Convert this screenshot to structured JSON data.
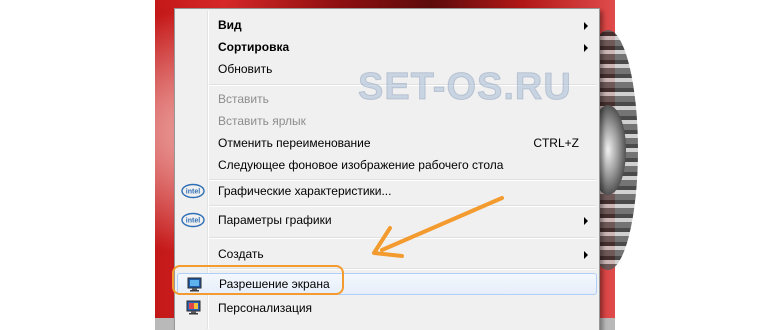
{
  "watermark": "SET-OS.RU",
  "menu": {
    "items": [
      {
        "label": "Вид",
        "shortcut": "",
        "submenu": true,
        "bold": true,
        "disabled": false,
        "icon": ""
      },
      {
        "label": "Сортировка",
        "shortcut": "",
        "submenu": true,
        "bold": true,
        "disabled": false,
        "icon": ""
      },
      {
        "label": "Обновить",
        "shortcut": "",
        "submenu": false,
        "bold": false,
        "disabled": false,
        "icon": ""
      },
      {
        "label": "Вставить",
        "shortcut": "",
        "submenu": false,
        "bold": false,
        "disabled": true,
        "icon": ""
      },
      {
        "label": "Вставить ярлык",
        "shortcut": "",
        "submenu": false,
        "bold": false,
        "disabled": true,
        "icon": ""
      },
      {
        "label": "Отменить переименование",
        "shortcut": "CTRL+Z",
        "submenu": false,
        "bold": false,
        "disabled": false,
        "icon": ""
      },
      {
        "label": "Следующее фоновое изображение рабочего стола",
        "shortcut": "",
        "submenu": false,
        "bold": false,
        "disabled": false,
        "icon": ""
      },
      {
        "label": "Графические характеристики...",
        "shortcut": "",
        "submenu": false,
        "bold": false,
        "disabled": false,
        "icon": "intel-icon"
      },
      {
        "label": "Параметры графики",
        "shortcut": "",
        "submenu": true,
        "bold": false,
        "disabled": false,
        "icon": "intel-icon"
      },
      {
        "label": "Создать",
        "shortcut": "",
        "submenu": true,
        "bold": false,
        "disabled": false,
        "icon": ""
      },
      {
        "label": "Разрешение экрана",
        "shortcut": "",
        "submenu": false,
        "bold": false,
        "disabled": false,
        "icon": "display-icon"
      },
      {
        "label": "Персонализация",
        "shortcut": "",
        "submenu": false,
        "bold": false,
        "disabled": false,
        "icon": "personalize-icon"
      }
    ],
    "intel_text": "intel"
  },
  "colors": {
    "callout": "#f39b2e",
    "menu_bg": "#f0f0f0",
    "disabled_text": "#8d8d8d"
  }
}
